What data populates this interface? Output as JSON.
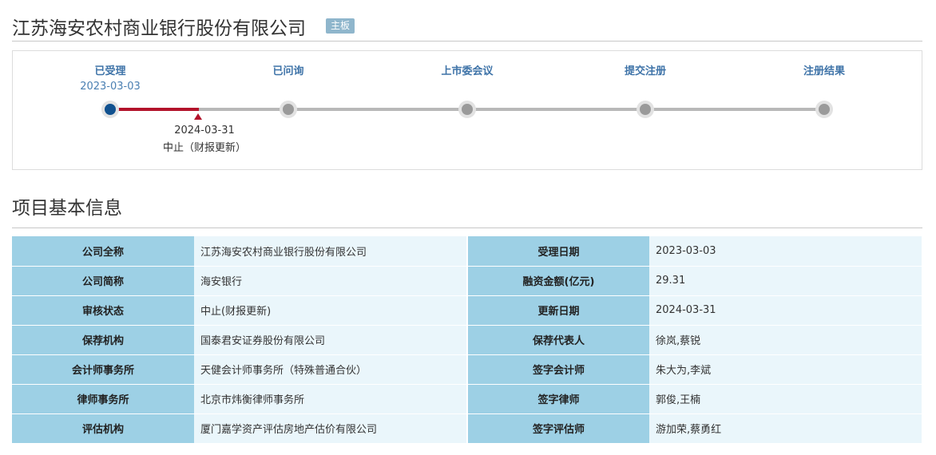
{
  "header": {
    "company_name": "江苏海安农村商业银行股份有限公司",
    "board_badge": "主板"
  },
  "progress": {
    "stages": [
      {
        "label": "已受理",
        "date": "2023-03-03",
        "active": true
      },
      {
        "label": "已问询",
        "date": "",
        "active": false
      },
      {
        "label": "上市委会议",
        "date": "",
        "active": false
      },
      {
        "label": "提交注册",
        "date": "",
        "active": false
      },
      {
        "label": "注册结果",
        "date": "",
        "active": false
      }
    ],
    "suspend": {
      "date": "2024-03-31",
      "status": "中止（财报更新）"
    },
    "colors": {
      "active_node": "#11518f",
      "progress_line": "#b3132b",
      "inactive_line": "#b8b8b8",
      "stage_label": "#3e73a8"
    }
  },
  "section": {
    "title": "项目基本信息"
  },
  "info_table": {
    "rows": [
      {
        "k1": "公司全称",
        "v1": "江苏海安农村商业银行股份有限公司",
        "k2": "受理日期",
        "v2": "2023-03-03"
      },
      {
        "k1": "公司简称",
        "v1": "海安银行",
        "k2": "融资金额(亿元)",
        "v2": "29.31"
      },
      {
        "k1": "审核状态",
        "v1": "中止(财报更新)",
        "k2": "更新日期",
        "v2": "2024-03-31"
      },
      {
        "k1": "保荐机构",
        "v1": "国泰君安证券股份有限公司",
        "k2": "保荐代表人",
        "v2": "徐岚,蔡锐"
      },
      {
        "k1": "会计师事务所",
        "v1": "天健会计师事务所（特殊普通合伙）",
        "k2": "签字会计师",
        "v2": "朱大为,李斌"
      },
      {
        "k1": "律师事务所",
        "v1": "北京市炜衡律师事务所",
        "k2": "签字律师",
        "v2": "郭俊,王楠"
      },
      {
        "k1": "评估机构",
        "v1": "厦门嘉学资产评估房地产估价有限公司",
        "k2": "签字评估师",
        "v2": "游加荣,蔡勇红"
      }
    ]
  }
}
